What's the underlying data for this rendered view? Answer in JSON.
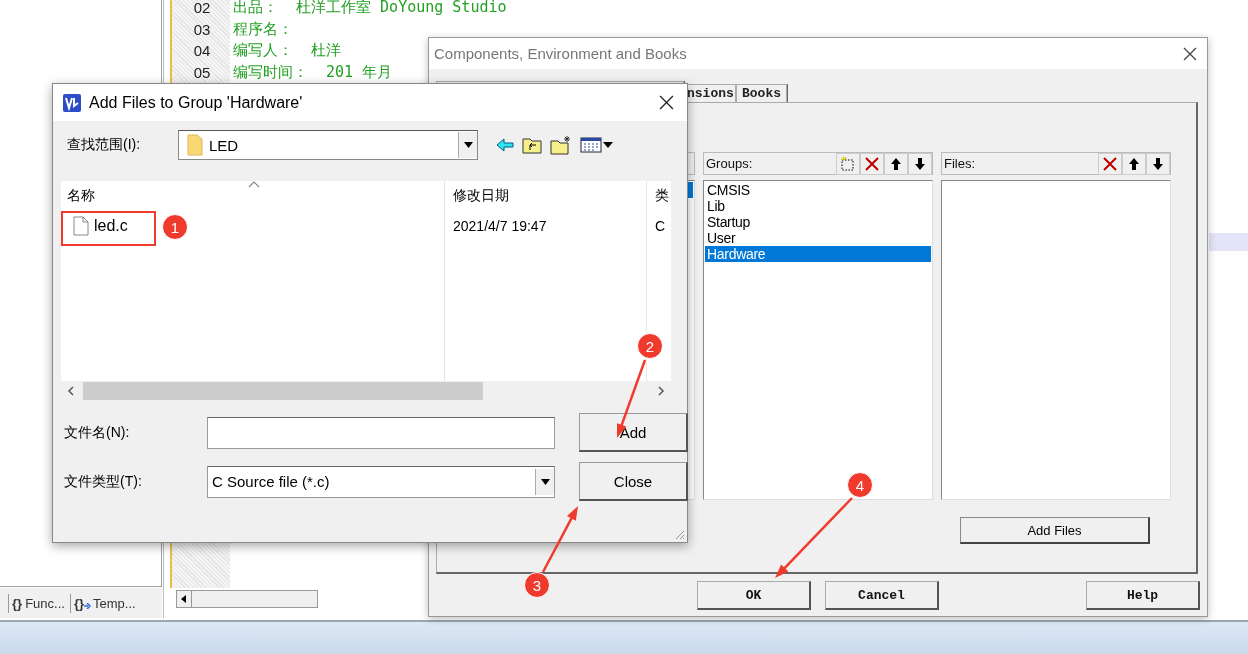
{
  "editor": {
    "code_lines": [
      {
        "number": "02",
        "text": "出品：  杜洋工作室 DoYoung Studio"
      },
      {
        "number": "03",
        "text": "程序名："
      },
      {
        "number": "04",
        "text": "编写人：  杜洋"
      },
      {
        "number": "05",
        "text": "编写时间：  201 年月"
      }
    ],
    "bottom_tabs": [
      {
        "icon": "{}",
        "label": "Func..."
      },
      {
        "icon": "{}",
        "label": "Temp..."
      }
    ]
  },
  "components_dialog": {
    "title": "Components, Environment and Books",
    "tabs": [
      {
        "label": "nsions",
        "selected": false
      },
      {
        "label": "Books",
        "selected": false
      }
    ],
    "groups_label": "Groups:",
    "groups": [
      {
        "label": "CMSIS",
        "selected": false
      },
      {
        "label": "Lib",
        "selected": false
      },
      {
        "label": "Startup",
        "selected": false
      },
      {
        "label": "User",
        "selected": false
      },
      {
        "label": "Hardware",
        "selected": true
      }
    ],
    "files_label": "Files:",
    "add_files_button": "Add Files",
    "buttons": [
      "OK",
      "Cancel",
      "Help"
    ]
  },
  "add_files_dialog": {
    "title": "Add Files to Group 'Hardware'",
    "look_in_label": "查找范围(I):",
    "look_in_value": "LED",
    "columns": [
      "名称",
      "修改日期",
      "类"
    ],
    "files": [
      {
        "name": "led.c",
        "modified": "2021/4/7 19:47",
        "type": "C"
      }
    ],
    "file_name_label": "文件名(N):",
    "file_type_label": "文件类型(T):",
    "file_type_value": "C Source file (*.c)",
    "buttons": [
      "Add",
      "Close"
    ]
  },
  "annotations": [
    {
      "number": "1"
    },
    {
      "number": "2"
    },
    {
      "number": "3"
    },
    {
      "number": "4"
    }
  ]
}
